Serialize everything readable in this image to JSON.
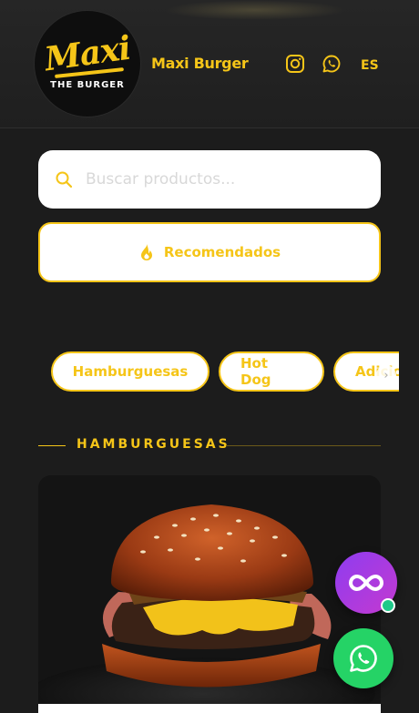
{
  "header": {
    "logo_script": "Maxi",
    "logo_sub": "THE BURGER",
    "brand_name": "Maxi Burger",
    "social": [
      "instagram-icon",
      "whatsapp-icon"
    ],
    "language": "ES"
  },
  "search": {
    "placeholder": "Buscar productos..."
  },
  "recommended": {
    "label": "Recomendados",
    "icon": "flame-icon"
  },
  "categories": [
    {
      "label": "Hamburguesas"
    },
    {
      "label": "Hot Dog"
    },
    {
      "label": "Adicionales"
    }
  ],
  "section": {
    "title": "HAMBURGUESAS"
  },
  "floating": {
    "chat_icon": "infinity-icon",
    "whatsapp_icon": "whatsapp-icon"
  },
  "colors": {
    "accent": "#f5c518",
    "background": "#1c1c1c",
    "whatsapp": "#25d366",
    "chat": "#9b3ce6"
  }
}
